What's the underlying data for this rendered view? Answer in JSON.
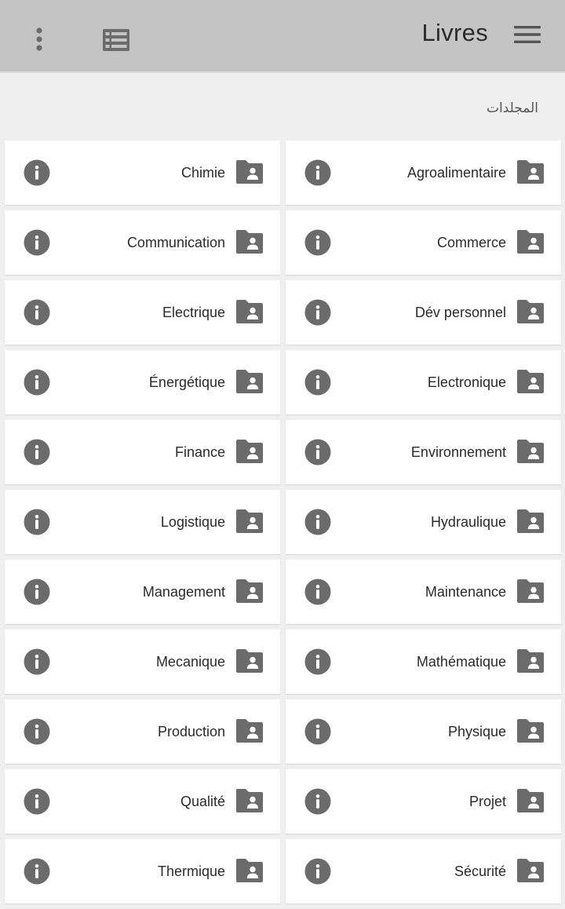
{
  "appbar": {
    "title": "Livres",
    "icons": {
      "more": "more-vertical-icon",
      "list": "list-view-icon",
      "menu": "hamburger-menu-icon"
    },
    "background_color": "#c4c4c4"
  },
  "section": {
    "title": "المجلدات"
  },
  "folders": [
    {
      "label": "Agroalimentaire"
    },
    {
      "label": "Chimie"
    },
    {
      "label": "Commerce"
    },
    {
      "label": "Communication"
    },
    {
      "label": "Dév personnel"
    },
    {
      "label": "Electrique"
    },
    {
      "label": "Electronique"
    },
    {
      "label": "Énergétique"
    },
    {
      "label": "Environnement"
    },
    {
      "label": "Finance"
    },
    {
      "label": "Hydraulique"
    },
    {
      "label": "Logistique"
    },
    {
      "label": "Maintenance"
    },
    {
      "label": "Management"
    },
    {
      "label": "Mathématique"
    },
    {
      "label": "Mecanique"
    },
    {
      "label": "Physique"
    },
    {
      "label": "Production"
    },
    {
      "label": "Projet"
    },
    {
      "label": "Qualité"
    },
    {
      "label": "Sécurité"
    },
    {
      "label": "Thermique"
    }
  ],
  "card_icons": {
    "folder": "folder-shared-icon",
    "info": "info-icon"
  },
  "colors": {
    "icon": "#6b6b6b",
    "page_background": "#efefef",
    "card_background": "#ffffff",
    "text": "#2b2b2b"
  }
}
